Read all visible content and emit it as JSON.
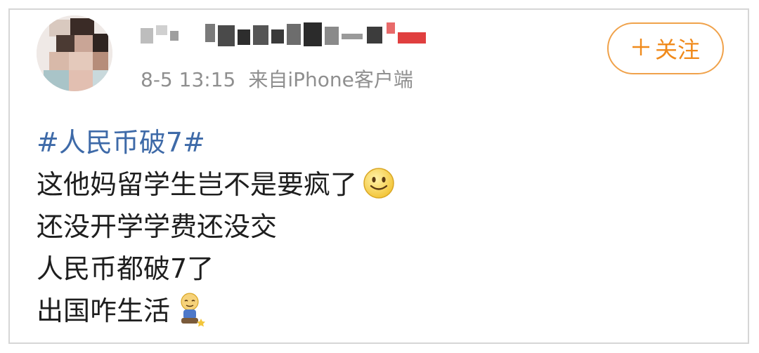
{
  "post": {
    "meta": {
      "time": "8-5 13:15",
      "source": "来自iPhone客户端"
    },
    "follow_label": "关注",
    "follow_icon": "plus-icon",
    "hashtag": "#人民币破7#",
    "lines": [
      "这他妈留学生岂不是要疯了",
      "还没开学学费还没交",
      "人民币都破7了",
      "出国咋生活"
    ],
    "emojis": [
      "smile-emoji",
      "kneeling-emoji"
    ],
    "accent_color": "#f08a1b",
    "link_color": "#3e6aa8"
  }
}
